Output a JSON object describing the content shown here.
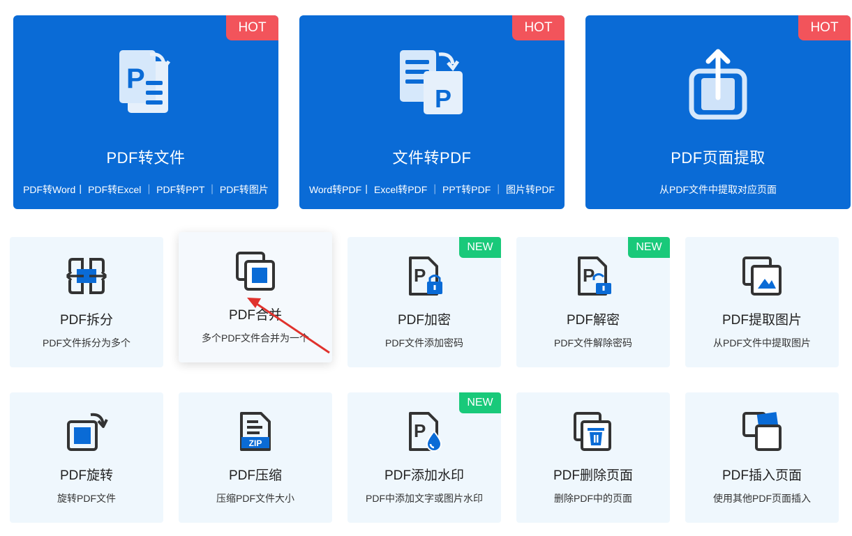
{
  "big_cards": [
    {
      "title": "PDF转文件",
      "badge": "HOT",
      "icon": "pdf-to-file-icon",
      "subtitle": "PDF转Word丨 PDF转Excel ｜ PDF转PPT ｜ PDF转图片"
    },
    {
      "title": "文件转PDF",
      "badge": "HOT",
      "icon": "file-to-pdf-icon",
      "subtitle": "Word转PDF丨 Excel转PDF ｜ PPT转PDF ｜ 图片转PDF"
    },
    {
      "title": "PDF页面提取",
      "badge": "HOT",
      "icon": "extract-page-icon",
      "subtitle": "从PDF文件中提取对应页面"
    }
  ],
  "row1": [
    {
      "title": "PDF拆分",
      "desc": "PDF文件拆分为多个",
      "badge": "",
      "icon": "split-icon"
    },
    {
      "title": "PDF合并",
      "desc": "多个PDF文件合并为一个",
      "badge": "",
      "icon": "merge-icon"
    },
    {
      "title": "PDF加密",
      "desc": "PDF文件添加密码",
      "badge": "NEW",
      "icon": "lock-icon"
    },
    {
      "title": "PDF解密",
      "desc": "PDF文件解除密码",
      "badge": "NEW",
      "icon": "unlock-icon"
    },
    {
      "title": "PDF提取图片",
      "desc": "从PDF文件中提取图片",
      "badge": "",
      "icon": "image-extract-icon"
    }
  ],
  "row2": [
    {
      "title": "PDF旋转",
      "desc": "旋转PDF文件",
      "badge": "",
      "icon": "rotate-icon"
    },
    {
      "title": "PDF压缩",
      "desc": "压缩PDF文件大小",
      "badge": "",
      "icon": "zip-icon",
      "icon_label": "ZIP"
    },
    {
      "title": "PDF添加水印",
      "desc": "PDF中添加文字或图片水印",
      "badge": "NEW",
      "icon": "watermark-icon"
    },
    {
      "title": "PDF删除页面",
      "desc": "删除PDF中的页面",
      "badge": "",
      "icon": "delete-page-icon"
    },
    {
      "title": "PDF插入页面",
      "desc": "使用其他PDF页面插入",
      "badge": "",
      "icon": "insert-page-icon"
    }
  ],
  "colors": {
    "primary_blue": "#0a6bd6",
    "hot_badge": "#f2545b",
    "new_badge": "#19c97a",
    "card_bg": "#eff7fd",
    "arrow": "#e0322d"
  }
}
